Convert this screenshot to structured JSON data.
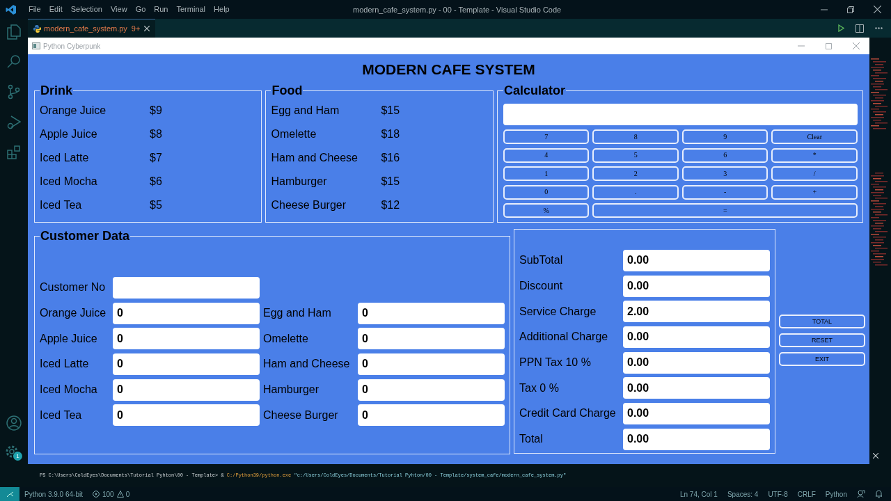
{
  "vscode": {
    "menu": [
      "File",
      "Edit",
      "Selection",
      "View",
      "Go",
      "Run",
      "Terminal",
      "Help"
    ],
    "title": "modern_cafe_system.py - 00 - Template - Visual Studio Code",
    "tab": {
      "label": "modern_cafe_system.py",
      "badge": "9+"
    },
    "settings_badge": "1",
    "terminal": {
      "prompt": "PS C:\\Users\\ColdEyes\\Documents\\Tutorial Pyhton\\00 - Template> &",
      "exe": "C:/Python39/python.exe",
      "arg": "\"c:/Users/ColdEyes/Documents/Tutorial Pyhton/00 - Template/system_cafe/modern_cafe_system.py\""
    },
    "status_bar": {
      "interpreter": "Python 3.9.0 64-bit",
      "errors": "100",
      "warnings": "0",
      "position": "Ln 74, Col 1",
      "spaces": "Spaces: 4",
      "encoding": "UTF-8",
      "eol": "CRLF",
      "language": "Python"
    }
  },
  "app": {
    "title": "Python Cyberpunk",
    "heading": "MODERN CAFE SYSTEM",
    "menus": [
      {
        "title": "Drink",
        "items": [
          {
            "name": "Orange Juice",
            "price": "$9"
          },
          {
            "name": "Apple Juice",
            "price": "$8"
          },
          {
            "name": "Iced Latte",
            "price": "$7"
          },
          {
            "name": "Iced Mocha",
            "price": "$6"
          },
          {
            "name": "Iced Tea",
            "price": "$5"
          }
        ]
      },
      {
        "title": "Food",
        "items": [
          {
            "name": "Egg and Ham",
            "price": "$15"
          },
          {
            "name": "Omelette",
            "price": "$18"
          },
          {
            "name": "Ham and Cheese",
            "price": "$16"
          },
          {
            "name": "Hamburger",
            "price": "$15"
          },
          {
            "name": "Cheese Burger",
            "price": "$12"
          }
        ]
      }
    ],
    "calculator": {
      "title": "Calculator",
      "keys": [
        {
          "label": "7",
          "wide": false
        },
        {
          "label": "8",
          "wide": false
        },
        {
          "label": "9",
          "wide": false
        },
        {
          "label": "Clear",
          "wide": false
        },
        {
          "label": "4",
          "wide": false
        },
        {
          "label": "5",
          "wide": false
        },
        {
          "label": "6",
          "wide": false
        },
        {
          "label": "*",
          "wide": false
        },
        {
          "label": "1",
          "wide": false
        },
        {
          "label": "2",
          "wide": false
        },
        {
          "label": "3",
          "wide": false
        },
        {
          "label": "/",
          "wide": false
        },
        {
          "label": "0",
          "wide": false
        },
        {
          "label": ".",
          "wide": false
        },
        {
          "label": "-",
          "wide": false
        },
        {
          "label": "+",
          "wide": false
        },
        {
          "label": "%",
          "wide": false
        },
        {
          "label": "=",
          "wide": true
        }
      ]
    },
    "customer": {
      "title": "Customer Data",
      "customer_no": {
        "label": "Customer No"
      },
      "drinks": [
        {
          "label": "Orange Juice",
          "value": "0"
        },
        {
          "label": "Apple Juice",
          "value": "0"
        },
        {
          "label": "Iced Latte",
          "value": "0"
        },
        {
          "label": "Iced Mocha",
          "value": "0"
        },
        {
          "label": "Iced Tea",
          "value": "0"
        }
      ],
      "food": [
        {
          "label": "Egg and Ham",
          "value": "0"
        },
        {
          "label": "Omelette",
          "value": "0"
        },
        {
          "label": "Ham and Cheese",
          "value": "0"
        },
        {
          "label": "Hamburger",
          "value": "0"
        },
        {
          "label": "Cheese Burger",
          "value": "0"
        }
      ]
    },
    "totals": [
      {
        "label": "SubTotal",
        "value": "0.00"
      },
      {
        "label": "Discount",
        "value": "0.00"
      },
      {
        "label": "Service Charge",
        "value": "2.00"
      },
      {
        "label": "Additional Charge",
        "value": "0.00"
      },
      {
        "label": "PPN Tax 10 %",
        "value": "0.00"
      },
      {
        "label": "Tax 0 %",
        "value": "0.00"
      },
      {
        "label": "Credit Card Charge",
        "value": "0.00"
      },
      {
        "label": "Total",
        "value": "0.00"
      }
    ],
    "buttons": [
      "TOTAL",
      "RESET",
      "EXIT"
    ]
  }
}
